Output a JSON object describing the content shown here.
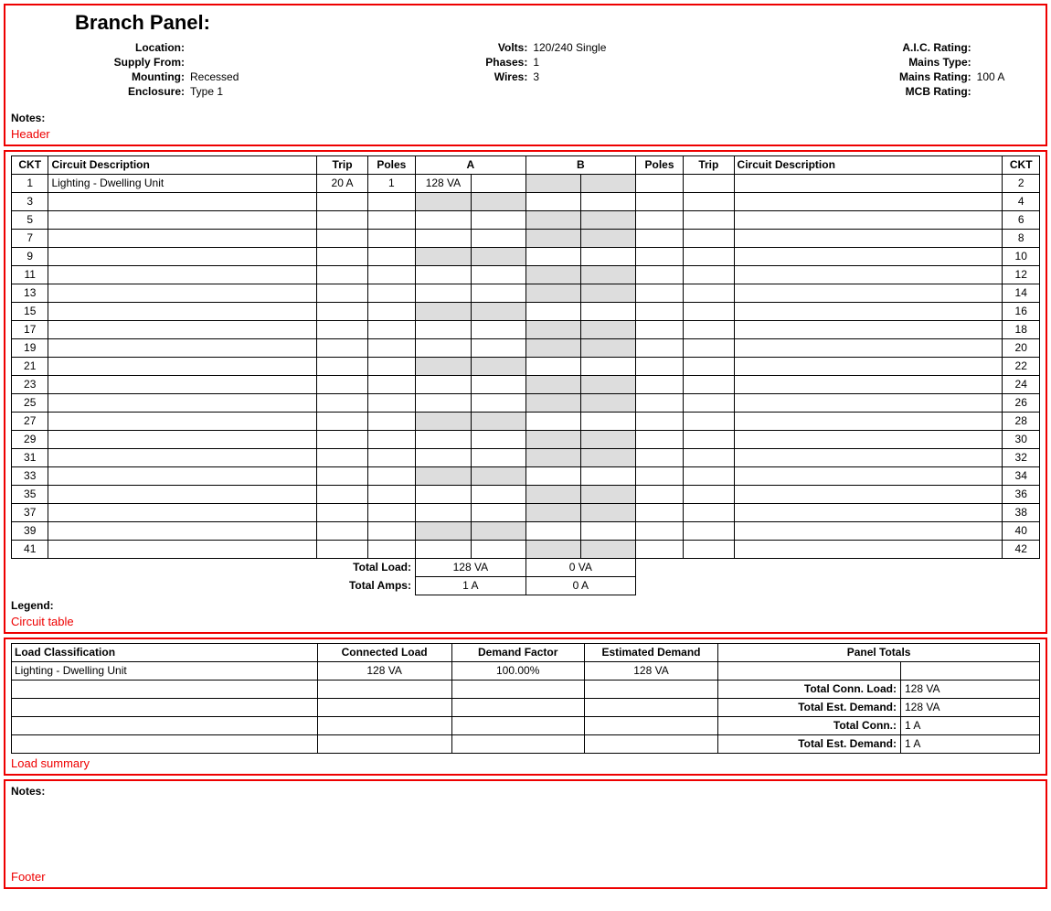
{
  "sections": {
    "header_label": "Header",
    "circuit_label": "Circuit table",
    "load_label": "Load summary",
    "footer_label": "Footer"
  },
  "header": {
    "title": "Branch Panel:",
    "notes_label": "Notes:",
    "left": {
      "location_label": "Location:",
      "location_value": "",
      "supply_label": "Supply From:",
      "supply_value": "",
      "mounting_label": "Mounting:",
      "mounting_value": "Recessed",
      "enclosure_label": "Enclosure:",
      "enclosure_value": "Type 1"
    },
    "mid": {
      "volts_label": "Volts:",
      "volts_value": "120/240 Single",
      "phases_label": "Phases:",
      "phases_value": "1",
      "wires_label": "Wires:",
      "wires_value": "3"
    },
    "right": {
      "aic_label": "A.I.C. Rating:",
      "aic_value": "",
      "mains_type_label": "Mains Type:",
      "mains_type_value": "",
      "mains_rating_label": "Mains Rating:",
      "mains_rating_value": "100 A",
      "mcb_label": "MCB Rating:",
      "mcb_value": ""
    }
  },
  "circuit": {
    "headers": {
      "ckt": "CKT",
      "desc": "Circuit Description",
      "trip": "Trip",
      "poles": "Poles",
      "a": "A",
      "b": "B"
    },
    "rows": [
      {
        "l": "1",
        "desc": "Lighting - Dwelling Unit",
        "trip": "20 A",
        "poles": "1",
        "a1": "128 VA",
        "a2": "",
        "shadeA": false,
        "shadeB": true,
        "r": "2"
      },
      {
        "l": "3",
        "shadeA": true,
        "shadeB": false,
        "r": "4"
      },
      {
        "l": "5",
        "shadeA": false,
        "shadeB": true,
        "r": "6"
      },
      {
        "l": "7",
        "shadeA": false,
        "shadeB": true,
        "r": "8"
      },
      {
        "l": "9",
        "shadeA": true,
        "shadeB": false,
        "r": "10"
      },
      {
        "l": "11",
        "shadeA": false,
        "shadeB": true,
        "r": "12"
      },
      {
        "l": "13",
        "shadeA": false,
        "shadeB": true,
        "r": "14"
      },
      {
        "l": "15",
        "shadeA": true,
        "shadeB": false,
        "r": "16"
      },
      {
        "l": "17",
        "shadeA": false,
        "shadeB": true,
        "r": "18"
      },
      {
        "l": "19",
        "shadeA": false,
        "shadeB": true,
        "r": "20"
      },
      {
        "l": "21",
        "shadeA": true,
        "shadeB": false,
        "r": "22"
      },
      {
        "l": "23",
        "shadeA": false,
        "shadeB": true,
        "r": "24"
      },
      {
        "l": "25",
        "shadeA": false,
        "shadeB": true,
        "r": "26"
      },
      {
        "l": "27",
        "shadeA": true,
        "shadeB": false,
        "r": "28"
      },
      {
        "l": "29",
        "shadeA": false,
        "shadeB": true,
        "r": "30"
      },
      {
        "l": "31",
        "shadeA": false,
        "shadeB": true,
        "r": "32"
      },
      {
        "l": "33",
        "shadeA": true,
        "shadeB": false,
        "r": "34"
      },
      {
        "l": "35",
        "shadeA": false,
        "shadeB": true,
        "r": "36"
      },
      {
        "l": "37",
        "shadeA": false,
        "shadeB": true,
        "r": "38"
      },
      {
        "l": "39",
        "shadeA": true,
        "shadeB": false,
        "r": "40"
      },
      {
        "l": "41",
        "shadeA": false,
        "shadeB": true,
        "r": "42"
      }
    ],
    "totals": {
      "load_label": "Total Load:",
      "load_a": "128 VA",
      "load_b": "0 VA",
      "amps_label": "Total Amps:",
      "amps_a": "1 A",
      "amps_b": "0 A"
    },
    "legend_label": "Legend:"
  },
  "load_summary": {
    "headers": {
      "class": "Load Classification",
      "conn": "Connected Load",
      "df": "Demand Factor",
      "ed": "Estimated Demand",
      "pt": "Panel Totals"
    },
    "rows": [
      {
        "class": "Lighting - Dwelling Unit",
        "conn": "128 VA",
        "df": "100.00%",
        "ed": "128 VA"
      },
      {},
      {},
      {},
      {}
    ],
    "panel_totals": [
      {
        "label": "",
        "value": ""
      },
      {
        "label": "Total Conn. Load:",
        "value": "128 VA"
      },
      {
        "label": "Total Est. Demand:",
        "value": "128 VA"
      },
      {
        "label": "Total Conn.:",
        "value": "1 A"
      },
      {
        "label": "Total Est. Demand:",
        "value": "1 A"
      }
    ]
  },
  "footer": {
    "notes_label": "Notes:"
  }
}
